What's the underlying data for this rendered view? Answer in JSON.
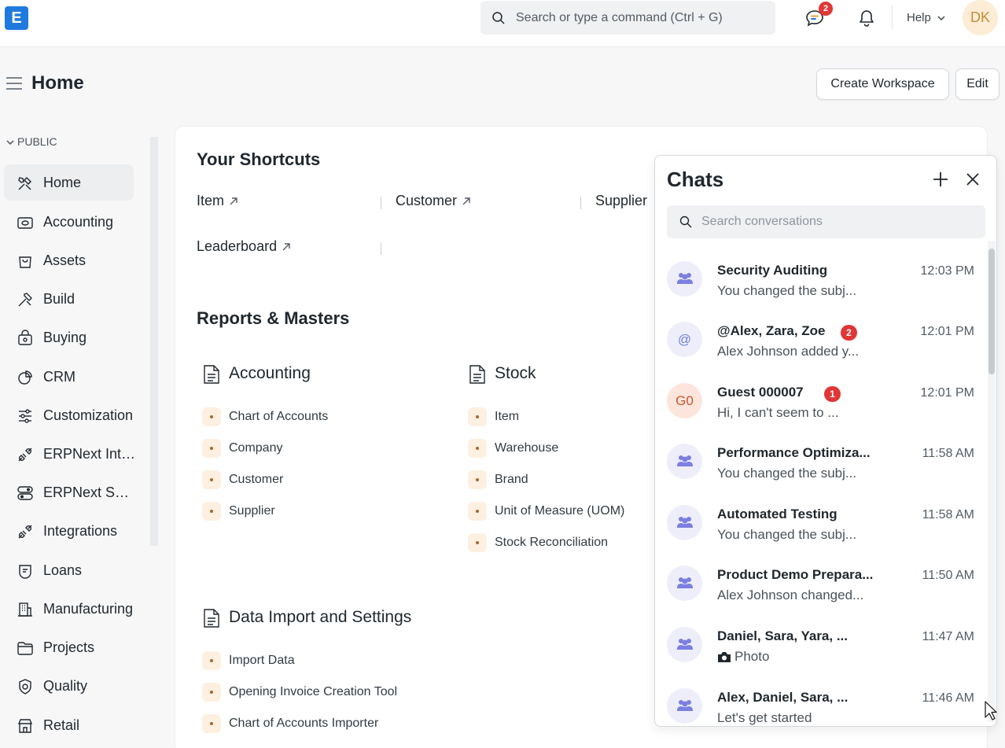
{
  "topbar": {
    "logo_letter": "E",
    "search_placeholder": "Search or type a command (Ctrl + G)",
    "chat_badge": "2",
    "help_label": "Help",
    "avatar_initials": "DK"
  },
  "page": {
    "title": "Home",
    "create_workspace_label": "Create Workspace",
    "edit_label": "Edit"
  },
  "sidebar": {
    "section_label": "PUBLIC",
    "items": [
      {
        "label": "Home",
        "icon": "tools-icon"
      },
      {
        "label": "Accounting",
        "icon": "wallet-icon"
      },
      {
        "label": "Assets",
        "icon": "bag-icon"
      },
      {
        "label": "Build",
        "icon": "hammer-icon"
      },
      {
        "label": "Buying",
        "icon": "basket-icon"
      },
      {
        "label": "CRM",
        "icon": "pie-icon"
      },
      {
        "label": "Customization",
        "icon": "sliders-icon"
      },
      {
        "label": "ERPNext Integrations",
        "icon": "plug-icon"
      },
      {
        "label": "ERPNext Settings",
        "icon": "toggle-icon"
      },
      {
        "label": "Integrations",
        "icon": "plug-icon"
      },
      {
        "label": "Loans",
        "icon": "loan-icon"
      },
      {
        "label": "Manufacturing",
        "icon": "building-icon"
      },
      {
        "label": "Projects",
        "icon": "folder-icon"
      },
      {
        "label": "Quality",
        "icon": "shield-icon"
      },
      {
        "label": "Retail",
        "icon": "store-icon"
      }
    ]
  },
  "shortcuts": {
    "title": "Your Shortcuts",
    "items": [
      "Item",
      "Customer",
      "Supplier",
      "Leaderboard"
    ]
  },
  "reports": {
    "title": "Reports & Masters",
    "cards": [
      {
        "title": "Accounting",
        "links": [
          "Chart of Accounts",
          "Company",
          "Customer",
          "Supplier"
        ]
      },
      {
        "title": "Stock",
        "links": [
          "Item",
          "Warehouse",
          "Brand",
          "Unit of Measure (UOM)",
          "Stock Reconciliation"
        ]
      },
      {
        "title": "Data Import and Settings",
        "links": [
          "Import Data",
          "Opening Invoice Creation Tool",
          "Chart of Accounts Importer"
        ]
      }
    ]
  },
  "chats": {
    "title": "Chats",
    "search_placeholder": "Search conversations",
    "rooms": [
      {
        "name": "Security Auditing",
        "time": "12:03 PM",
        "message": "You changed the subj...",
        "avatar": "group",
        "badge": ""
      },
      {
        "name": "@Alex, Zara, Zoe",
        "time": "12:01 PM",
        "message": "Alex Johnson added y...",
        "avatar": "@",
        "badge": "2"
      },
      {
        "name": "Guest 000007",
        "time": "12:01 PM",
        "message": "Hi, I can't seem to ...",
        "avatar": "G0",
        "badge": "1"
      },
      {
        "name": "Performance Optimiza...",
        "time": "11:58 AM",
        "message": "You changed the subj...",
        "avatar": "group",
        "badge": ""
      },
      {
        "name": "Automated Testing",
        "time": "11:58 AM",
        "message": "You changed the subj...",
        "avatar": "group",
        "badge": ""
      },
      {
        "name": "Product Demo Prepara...",
        "time": "11:50 AM",
        "message": "Alex Johnson changed...",
        "avatar": "group",
        "badge": ""
      },
      {
        "name": "Daniel, Sara, Yara, ...",
        "time": "11:47 AM",
        "message": "Photo",
        "avatar": "group",
        "badge": ""
      },
      {
        "name": "Alex, Daniel, Sara, ...",
        "time": "11:46 AM",
        "message": "Let's get started",
        "avatar": "group",
        "badge": ""
      }
    ]
  }
}
